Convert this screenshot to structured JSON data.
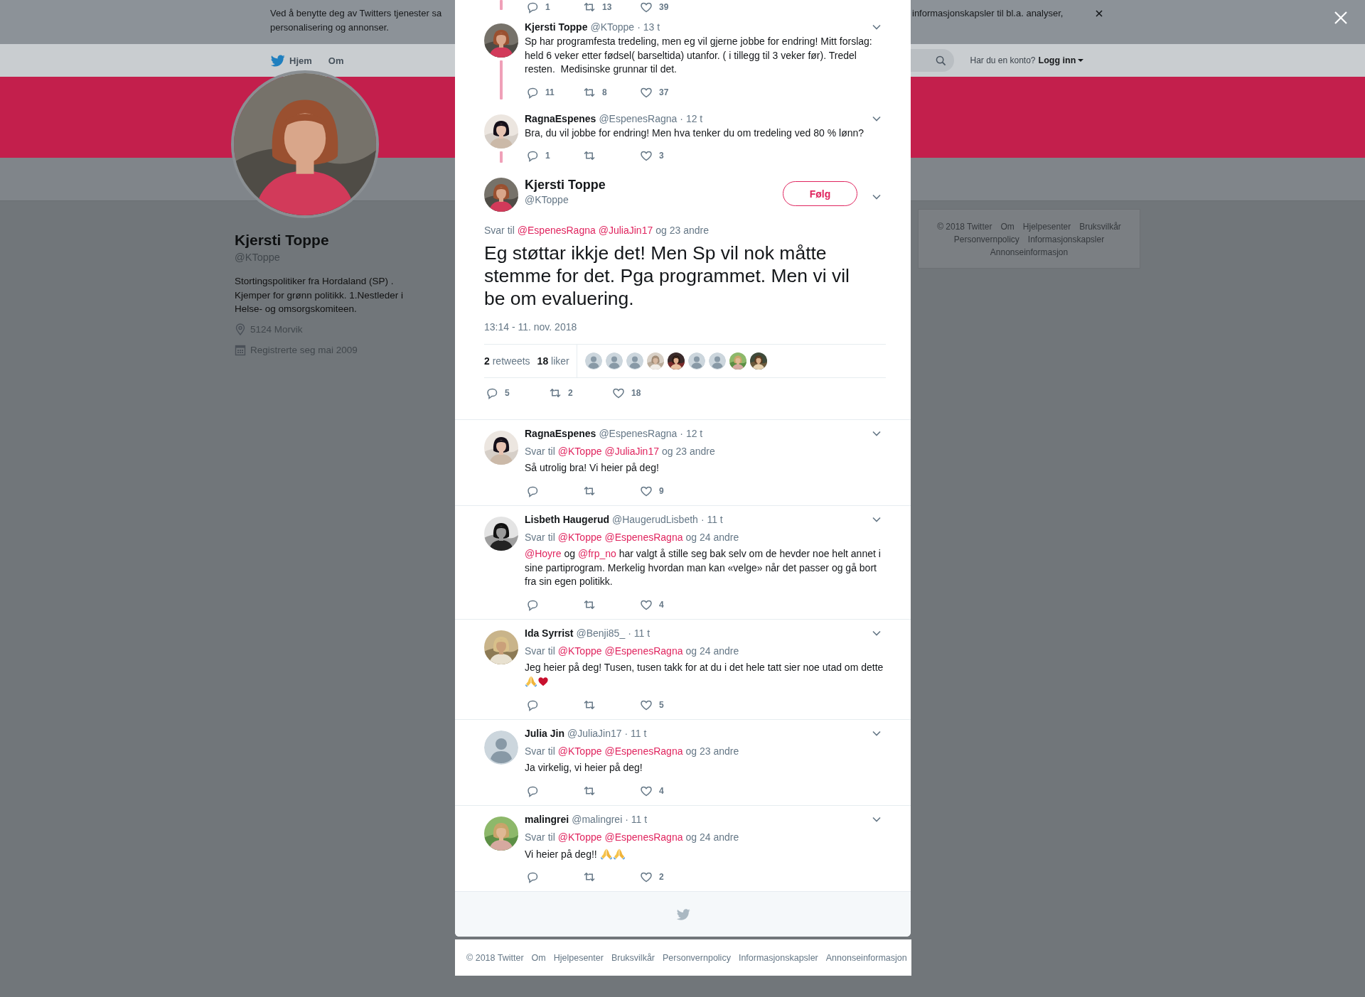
{
  "cookie_banner": {
    "line1_left": "Ved å benytte deg av Twitters tjenester sa",
    "line1_right": "informasjonskapsler til bl.a. analyser,",
    "line2": "personalisering og annonser."
  },
  "nav": {
    "items": [
      "Hjem",
      "Om"
    ],
    "login_prompt": "Har du en konto?",
    "login_link": "Logg inn"
  },
  "profile": {
    "name": "Kjersti Toppe",
    "handle": "@KToppe",
    "bio": "Stortingspolitiker fra Hordaland (SP) . Kjemper for grønn politikk. 1.Nestleder i Helse- og omsorgskomiteen.",
    "location": "5124 Morvik",
    "joined": "Registrerte seg mai 2009"
  },
  "side_footer": [
    "© 2018 Twitter",
    "Om",
    "Hjelpesenter",
    "Bruksvilkår",
    "Personvernpolicy",
    "Informasjonskapsler",
    "Annonseinformasjon"
  ],
  "thread": {
    "top_actions": [
      {
        "kind": "reply",
        "count": "1"
      },
      {
        "kind": "retweet",
        "count": "13"
      },
      {
        "kind": "like",
        "count": "39"
      }
    ],
    "tweets": [
      {
        "avatar": {
          "kind": "picture"
        },
        "name": "Kjersti Toppe",
        "handle": "@KToppe",
        "time": "· 13 t",
        "text": "Sp har programfesta tredeling, men eg vil gjerne jobbe for endring! Mitt forslag: held 6 veker etter fødsel( barseltida) utanfor. ( i tillegg til 3 veker før). Tredel resten.  Medisinske grunnar til det.",
        "actions": [
          {
            "kind": "reply",
            "count": "11"
          },
          {
            "kind": "retweet",
            "count": "8"
          },
          {
            "kind": "like",
            "count": "37"
          }
        ]
      },
      {
        "avatar": {
          "kind": "picture"
        },
        "name": "RagnaEspenes",
        "handle": "@EspenesRagna",
        "time": "· 12 t",
        "text": "Bra, du vil jobbe for endring! Men hva tenker du om tredeling ved 80 % lønn?",
        "actions": [
          {
            "kind": "reply",
            "count": "1"
          },
          {
            "kind": "retweet"
          },
          {
            "kind": "like",
            "count": "3"
          }
        ]
      }
    ]
  },
  "main": {
    "avatar": {
      "kind": "picture"
    },
    "name": "Kjersti Toppe",
    "handle": "@KToppe",
    "follow": "Følg",
    "reply_to": {
      "label": "Svar til",
      "mentions": [
        "@EspenesRagna",
        "@JuliaJin17"
      ],
      "others": "og 23 andre"
    },
    "text": "Eg støttar ikkje det! Men Sp vil nok måtte stemme for det. Pga programmet. Men vi vil be om evaluering.",
    "timestamp": "13:14 - 11. nov. 2018",
    "retweets": "**2** retweets",
    "likes": "**18** liker",
    "likers": [
      {
        "kind": "default"
      },
      {
        "kind": "default"
      },
      {
        "kind": "default"
      },
      {
        "kind": "picture"
      },
      {
        "kind": "picture"
      },
      {
        "kind": "default"
      },
      {
        "kind": "default"
      },
      {
        "kind": "picture"
      },
      {
        "kind": "picture"
      }
    ],
    "actions": [
      {
        "kind": "reply",
        "count": "5"
      },
      {
        "kind": "retweet",
        "count": "2"
      },
      {
        "kind": "like",
        "count": "18"
      }
    ]
  },
  "replies": [
    {
      "avatar": {
        "kind": "picture"
      },
      "name": "RagnaEspenes",
      "handle": "@EspenesRagna",
      "time": "· 12 t",
      "reply_to": {
        "label": "Svar til",
        "mentions": [
          "@KToppe",
          "@JuliaJin17"
        ],
        "others": "og 23 andre"
      },
      "text": "Så utrolig bra! Vi heier på deg!",
      "actions": [
        {
          "kind": "reply"
        },
        {
          "kind": "retweet"
        },
        {
          "kind": "like",
          "count": "9"
        }
      ]
    },
    {
      "avatar": {
        "kind": "picture"
      },
      "name": "Lisbeth Haugerud",
      "handle": "@HaugerudLisbeth",
      "time": "· 11 t",
      "reply_to": {
        "label": "Svar til",
        "mentions": [
          "@KToppe",
          "@EspenesRagna"
        ],
        "others": "og 24 andre"
      },
      "parts": [
        {
          "kind": "mention",
          "text": "@Hoyre"
        },
        {
          "kind": "text",
          "text": " og "
        },
        {
          "kind": "mention",
          "text": "@frp_no"
        },
        {
          "kind": "text",
          "text": " har valgt å stille seg bak selv om de hevder noe helt annet i sine partiprogram. Merkelig hvordan man kan «velge» når det passer og gå bort fra sin egen politikk."
        }
      ],
      "actions": [
        {
          "kind": "reply"
        },
        {
          "kind": "retweet"
        },
        {
          "kind": "like",
          "count": "4"
        }
      ]
    },
    {
      "avatar": {
        "kind": "picture"
      },
      "name": "Ida Syrrist",
      "handle": "@Benji85_",
      "time": "· 11 t",
      "reply_to": {
        "label": "Svar til",
        "mentions": [
          "@KToppe",
          "@EspenesRagna"
        ],
        "others": "og 24 andre"
      },
      "parts": [
        {
          "kind": "text",
          "text": "Jeg heier på deg! Tusen, tusen takk for at du i det hele tatt sier noe utad om dette "
        },
        {
          "kind": "hands-emoji"
        },
        {
          "kind": "heart-emoji"
        }
      ],
      "actions": [
        {
          "kind": "reply"
        },
        {
          "kind": "retweet"
        },
        {
          "kind": "like",
          "count": "5"
        }
      ]
    },
    {
      "avatar": {
        "kind": "default"
      },
      "name": "Julia Jin",
      "handle": "@JuliaJin17",
      "time": "· 11 t",
      "reply_to": {
        "label": "Svar til",
        "mentions": [
          "@KToppe",
          "@EspenesRagna"
        ],
        "others": "og 23 andre"
      },
      "text": "Ja virkelig, vi heier på deg!",
      "actions": [
        {
          "kind": "reply"
        },
        {
          "kind": "retweet"
        },
        {
          "kind": "like",
          "count": "4"
        }
      ]
    },
    {
      "avatar": {
        "kind": "picture"
      },
      "name": "malingrei",
      "handle": "@malingrei",
      "time": "· 11 t",
      "reply_to": {
        "label": "Svar til",
        "mentions": [
          "@KToppe",
          "@EspenesRagna"
        ],
        "others": "og 24 andre"
      },
      "parts": [
        {
          "kind": "text",
          "text": "Vi heier på deg!! "
        },
        {
          "kind": "hands-emoji"
        },
        {
          "kind": "hands-emoji"
        }
      ],
      "actions": [
        {
          "kind": "reply"
        },
        {
          "kind": "retweet"
        },
        {
          "kind": "like",
          "count": "2"
        }
      ]
    }
  ],
  "footer": [
    "© 2018 Twitter",
    "Om",
    "Hjelpesenter",
    "Bruksvilkår",
    "Personvernpolicy",
    "Informasjonskapsler",
    "Annonseinformasjon"
  ]
}
